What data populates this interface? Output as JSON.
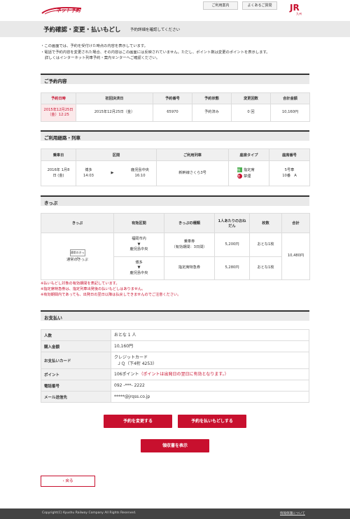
{
  "header": {
    "logo_text": "ネット予約",
    "guide_label": "ご利用案内",
    "faq_label": "よくあるご質問",
    "jr_logo": "JR",
    "jr_logo_sub": "九州"
  },
  "titlebar": {
    "title": "予約確認・変更・払いもどし",
    "subtitle": "予約詳細を確認してください"
  },
  "notes": [
    "・この画面では、予約を受付けた時点の内容を表示しています。",
    "・電話で予約内容を変更された場合、その内容はこの画面には反映されていません。ただし、ポイント数は変更のポイントを表示します。",
    "詳しくはインターネット列車予約・案内センターへご確認ください。"
  ],
  "reservation": {
    "heading": "ご予約内容",
    "headers": [
      "予約日時",
      "初回決済日",
      "予約番号",
      "予約状態",
      "変更回数",
      "合計金額"
    ],
    "row": [
      "2015年12月25日（金）12:25",
      "2015年12月25日（金）",
      "65970",
      "予約済み",
      "0 回",
      "10,160円"
    ]
  },
  "route": {
    "heading": "ご利用経路・列車",
    "headers": [
      "乗車日",
      "区間",
      "ご利用列車",
      "座席タイプ",
      "座席番号"
    ],
    "row": {
      "date": "2016年 1月8日 (金)",
      "from": "博多",
      "from_time": "14:03",
      "to": "鹿児島中央",
      "to_time": "16:10",
      "train": "新幹線さくら3号",
      "seat_type_1": "指定席",
      "seat_type_2": "禁煙",
      "seat_icon_1": "指",
      "seat_icon_2": "禁",
      "car": "5号車",
      "seat": "10番　A"
    }
  },
  "tickets": {
    "heading": "きっぷ",
    "headers": [
      "きっぷ",
      "有効区間",
      "きっぷの種類",
      "1人あたりのおねだん",
      "枚数",
      "合計"
    ],
    "ticket_thumb": "通常のきっぷ",
    "ticket_label": "通常のきっぷ",
    "rows": [
      {
        "from": "福岡市内",
        "arrow": "▼",
        "to": "鹿児島中央",
        "kind": "乗車券",
        "kind_note": "（有効期間：3日間）",
        "price": "5,200円",
        "count": "おとな1枚"
      },
      {
        "from": "博多",
        "arrow": "▼",
        "to": "鹿児島中央",
        "kind": "指定席特急券",
        "kind_note": "",
        "price": "5,280円",
        "count": "おとな1枚"
      }
    ],
    "total": "10,480円"
  },
  "red_notes": [
    "※払いもどし対象の有効期間を表記しています。",
    "※指定席特急券は、指定列車出発後の払いもどしはありません。",
    "※有効期間内であっても、出発日の翌日以降は払戻しできませんのでご注意ください。"
  ],
  "payment": {
    "heading": "お支払い",
    "rows": [
      {
        "label": "人数",
        "value": "おとな 1 人",
        "note": ""
      },
      {
        "label": "購入金額",
        "value": "10,160円",
        "note": ""
      },
      {
        "label": "お支払いカード",
        "value": "クレジットカード",
        "note": "ＪＱ（下4桁 4253）"
      },
      {
        "label": "ポイント",
        "value": "106ポイント",
        "note": "（ポイントは出発日の翌日に有効となります。）"
      },
      {
        "label": "電話番号",
        "value": "092 -***- 2222",
        "note": ""
      },
      {
        "label": "メール送信先",
        "value": "*****@jrqss.co.jp",
        "note": ""
      }
    ]
  },
  "buttons": {
    "change": "予約を変更する",
    "refund": "予約を払いもどしする",
    "receipt": "領収書を表示",
    "back": "戻る"
  },
  "footer": {
    "copyright": "Copyright(C) Kyushu Railway Company All Rights Reserved.",
    "policy": "情報保護について"
  },
  "colors": {
    "accent": "#c8102e",
    "header_bg": "#e9e9e9",
    "footer_bg": "#444444"
  }
}
